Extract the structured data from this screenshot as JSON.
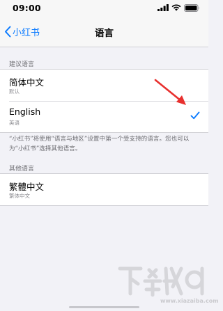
{
  "status_bar": {
    "time": "09:00",
    "icons": [
      "cellular-signal-icon",
      "wifi-icon",
      "battery-icon"
    ]
  },
  "nav": {
    "back_label": "小红书",
    "title": "语言"
  },
  "suggested": {
    "header": "建议语言",
    "rows": [
      {
        "title": "简体中文",
        "subtitle": "默认",
        "selected": false
      },
      {
        "title": "English",
        "subtitle": "英语",
        "selected": true
      }
    ]
  },
  "footer_note": "“小红书”将使用“语言与地区”设置中第一个受支持的语言。您也可以为“小红书”选择其他语言。",
  "other": {
    "header": "其他语言",
    "rows": [
      {
        "title": "繁體中文",
        "subtitle": "繁体中文"
      }
    ]
  },
  "watermark": {
    "text": "www.xiazaiba.com"
  },
  "colors": {
    "accent": "#0a7aff",
    "annotation_arrow": "#e8302e",
    "background": "#f2f2f7",
    "secondary_text": "#8e8e93"
  }
}
